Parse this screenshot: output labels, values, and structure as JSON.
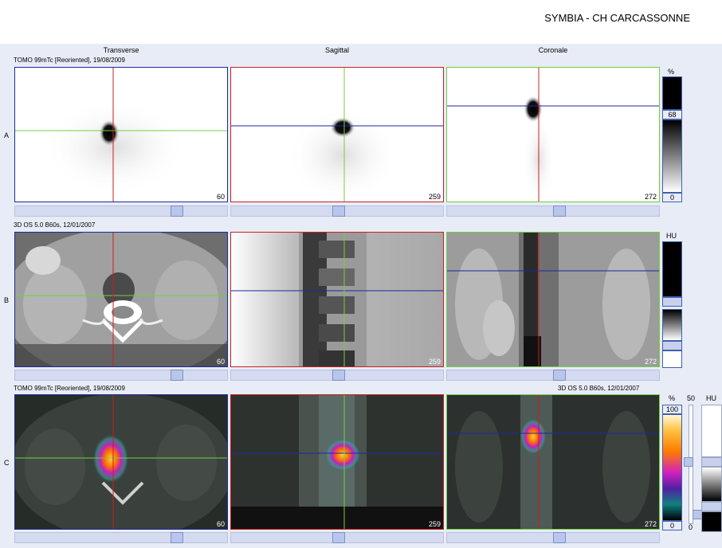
{
  "site_title": "SYMBIA - CH CARCASSONNE",
  "columns": [
    "Transverse",
    "Sagittal",
    "Coronale"
  ],
  "rows": [
    {
      "label": "A",
      "series": "TOMO 99mTc [Reoriented], 19/08/2009",
      "series_right": "",
      "slices": [
        "60",
        "259",
        "272"
      ],
      "colorbar": {
        "unit": "%",
        "top": "68",
        "bottom": "0"
      }
    },
    {
      "label": "B",
      "series": "3D  OS  5.0  B60s, 12/01/2007",
      "series_right": "",
      "slices": [
        "60",
        "259",
        "272"
      ],
      "colorbar": {
        "unit": "HU",
        "top": "",
        "bottom": ""
      }
    },
    {
      "label": "C",
      "series": "TOMO 99mTc [Reoriented], 19/08/2009",
      "series_right": "3D  OS  5.0  B60s, 12/01/2007",
      "slices": [
        "60",
        "259",
        "272"
      ],
      "colorbar": {
        "unit": "%",
        "top": "100",
        "bottom": "0"
      }
    }
  ],
  "fusion_controls": {
    "blend_top": "50",
    "blend_bottom": "0",
    "unit2": "HU"
  },
  "colors": {
    "blue_line": "#1a2aa0",
    "red_line": "#c82020",
    "green_line": "#70d040",
    "panel_bg": "#e8ecf6"
  }
}
